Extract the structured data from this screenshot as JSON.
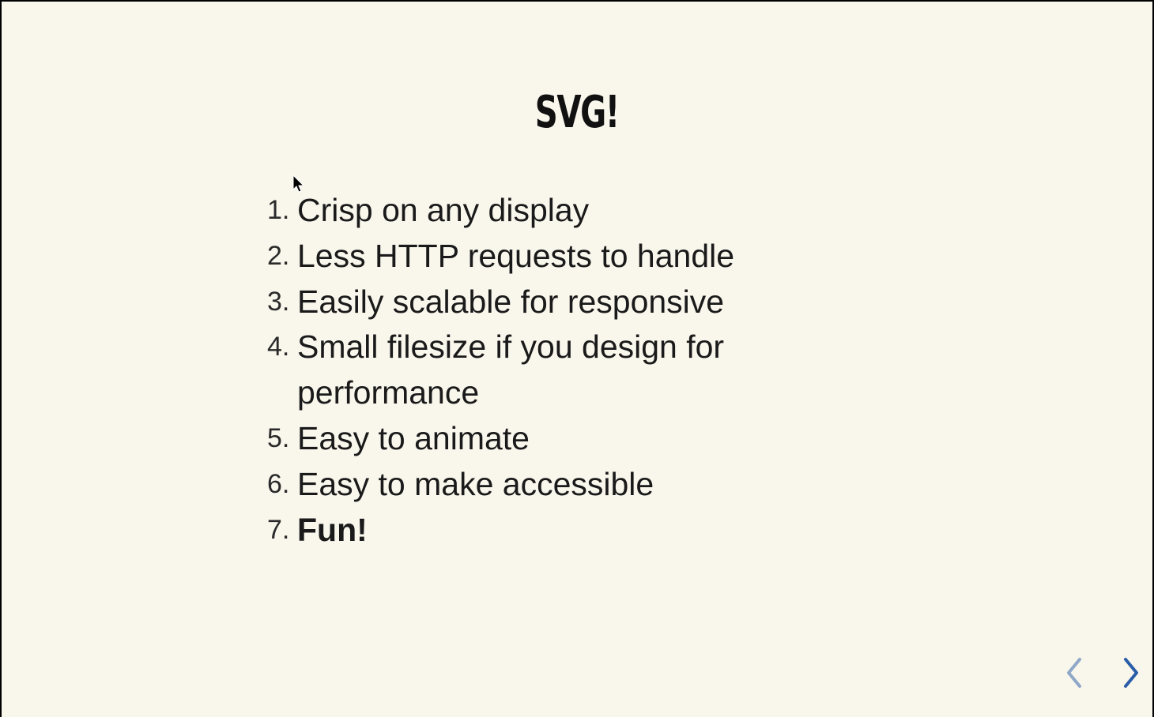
{
  "slide": {
    "title": "SVG!",
    "items": [
      {
        "number": "1.",
        "text": "Crisp on any display"
      },
      {
        "number": "2.",
        "text": "Less HTTP requests to handle"
      },
      {
        "number": "3.",
        "text": "Easily scalable for responsive"
      },
      {
        "number": "4.",
        "text": "Small filesize if you design for performance"
      },
      {
        "number": "5.",
        "text": "Easy to animate"
      },
      {
        "number": "6.",
        "text": "Easy to make accessible"
      },
      {
        "number": "7.",
        "text": "Fun!"
      }
    ]
  },
  "nav": {
    "prev_icon": "chevron-left-icon",
    "next_icon": "chevron-right-icon",
    "prev_color": "#8fa8c8",
    "next_color": "#2a5ea8"
  },
  "colors": {
    "background": "#f9f6ec",
    "text": "#1a1a1a"
  }
}
